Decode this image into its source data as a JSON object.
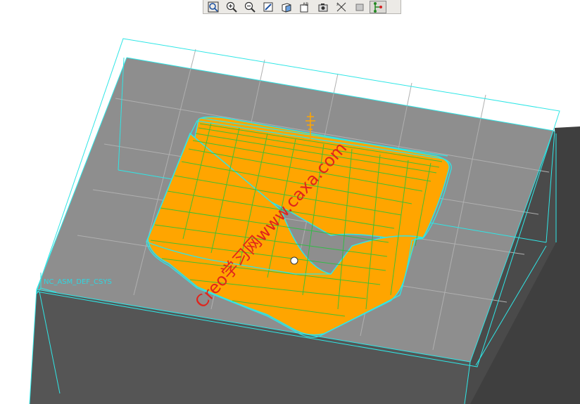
{
  "toolbar": {
    "buttons": [
      {
        "name": "zoom-fit",
        "icon": "refit-icon",
        "tooltip": ""
      },
      {
        "name": "zoom-in",
        "icon": "zoom-in-icon"
      },
      {
        "name": "zoom-out",
        "icon": "zoom-out-icon"
      },
      {
        "name": "repaint",
        "icon": "repaint-icon"
      },
      {
        "name": "display-style",
        "icon": "display-style-icon"
      },
      {
        "name": "saved-views",
        "icon": "saved-views-icon"
      },
      {
        "name": "view-manager",
        "icon": "camera-icon"
      },
      {
        "name": "datum-display",
        "icon": "datum-display-icon"
      },
      {
        "name": "spin-center",
        "icon": "spin-center-icon"
      },
      {
        "name": "annotation-display",
        "icon": "annotation-icon"
      }
    ]
  },
  "viewport": {
    "csys_label": "NC_ASM_DEF_CSYS",
    "watermark": "Creo学习网www.caxa.com",
    "colors": {
      "workpiece_top": "#8c8c8c",
      "workpiece_side": "#595959",
      "workpiece_front": "#4e4e4e",
      "toolpath": "#ffa500",
      "toolpath_lines": "#22c43a",
      "edge_highlight": "#2fe6e6",
      "watermark": "#e0241c"
    }
  }
}
